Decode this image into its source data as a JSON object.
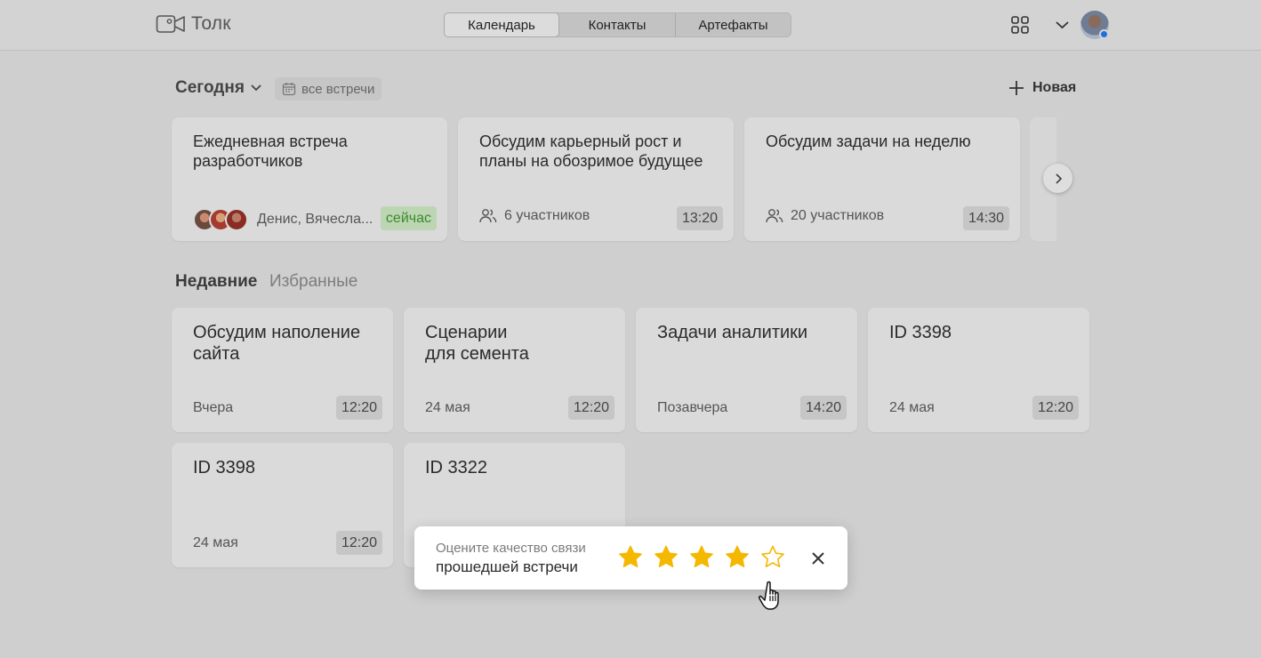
{
  "app": {
    "name": "Толк"
  },
  "nav": {
    "tabs": [
      "Календарь",
      "Контакты",
      "Артефакты"
    ],
    "active": "Календарь"
  },
  "colors": {
    "accent_online": "#1f6fe0",
    "now_badge_bg": "#bcd5b3",
    "now_badge_text": "#3c8a2c",
    "star": "#f5b800"
  },
  "today": {
    "title": "Сегодня",
    "all_meetings_label": "все встречи",
    "new_label": "Новая",
    "cards": [
      {
        "title": "Ежедневная встреча разработчиков",
        "meta": "Денис, Вячесла...",
        "badge": "сейчас"
      },
      {
        "title": "Обсудим карьерный рост и планы на обозримое будущее",
        "meta": "6 участников",
        "time": "13:20"
      },
      {
        "title": "Обсудим задачи на неделю",
        "meta": "20 участников",
        "time": "14:30"
      }
    ]
  },
  "recent": {
    "tabs": [
      "Недавние",
      "Избранные"
    ],
    "cards": [
      {
        "title": "Обсудим наполение\nсайта",
        "date": "Вчера",
        "time": "12:20"
      },
      {
        "title": "Сценарии\nдля семента",
        "date": "24 мая",
        "time": "12:20"
      },
      {
        "title": "Задачи аналитики",
        "date": "Позавчера",
        "time": "14:20"
      },
      {
        "title": "ID 3398",
        "date": "24 мая",
        "time": "12:20"
      },
      {
        "title": "ID 3398",
        "date": "24 мая",
        "time": "12:20"
      },
      {
        "title": "ID 3322",
        "date": "",
        "time": ""
      }
    ]
  },
  "rating": {
    "line1": "Оцените качество связи",
    "line2": "прошедшей встречи",
    "selected": 4,
    "max": 5
  },
  "icons": [
    "camera-logo-icon",
    "apps-grid-icon",
    "chevron-down-icon",
    "calendar-icon",
    "plus-icon",
    "people-icon",
    "chevron-right-icon",
    "star-icon",
    "close-icon",
    "hand-cursor-icon"
  ]
}
